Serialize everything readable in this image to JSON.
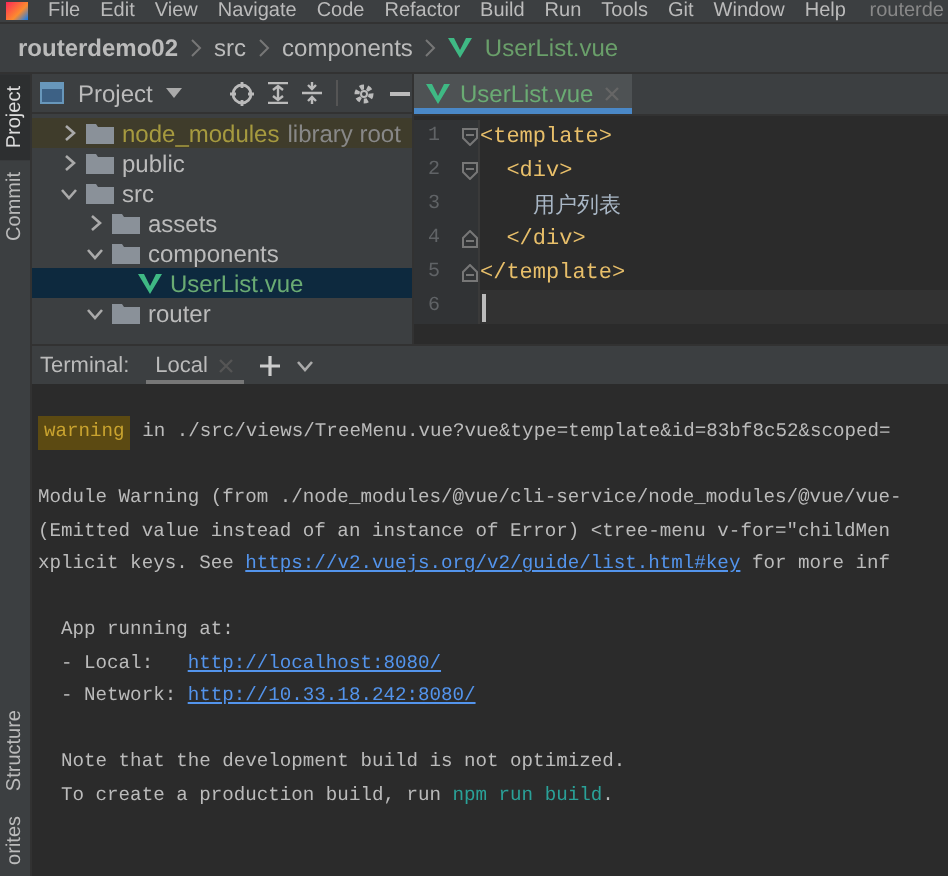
{
  "menu_bar": {
    "items": [
      "File",
      "Edit",
      "View",
      "Navigate",
      "Code",
      "Refactor",
      "Build",
      "Run",
      "Tools",
      "Git",
      "Window",
      "Help"
    ],
    "title": "routerde"
  },
  "breadcrumb": [
    "routerdemo02",
    "src",
    "components",
    "UserList.vue"
  ],
  "tool_strip": {
    "top": [
      {
        "label": "Project",
        "selected": true
      },
      {
        "label": "Commit",
        "selected": false
      }
    ],
    "bottom": [
      "Structure",
      "orites"
    ]
  },
  "project_panel": {
    "title": "Project",
    "tree": [
      {
        "label": "node_modules",
        "note": "library root",
        "kind": "excluded",
        "expanded": false,
        "selected": false
      },
      {
        "label": "public",
        "kind": "folder",
        "expanded": false,
        "selected": false
      },
      {
        "label": "src",
        "kind": "folder",
        "expanded": true,
        "selected": false,
        "children": [
          {
            "label": "assets",
            "kind": "folder",
            "expanded": false,
            "selected": false
          },
          {
            "label": "components",
            "kind": "folder",
            "expanded": true,
            "selected": false,
            "children": [
              {
                "label": "UserList.vue",
                "kind": "vue",
                "selected": true
              }
            ]
          },
          {
            "label": "router",
            "kind": "folder",
            "expanded": true,
            "selected": false
          }
        ]
      }
    ]
  },
  "editor": {
    "tabs": [
      {
        "label": "UserList.vue",
        "selected": true
      }
    ],
    "lines": [
      {
        "number": "1",
        "fold_start": true,
        "fold_end": false,
        "kind": "tag",
        "text": "<template>",
        "current": false
      },
      {
        "number": "2",
        "fold_start": true,
        "fold_end": false,
        "kind": "tag",
        "text": "  <div>",
        "current": false
      },
      {
        "number": "3",
        "fold_start": false,
        "fold_end": false,
        "kind": "text",
        "text": "    用户列表",
        "current": false
      },
      {
        "number": "4",
        "fold_start": false,
        "fold_end": true,
        "kind": "tag",
        "text": "  </div>",
        "current": false
      },
      {
        "number": "5",
        "fold_start": false,
        "fold_end": true,
        "kind": "tag",
        "text": "</template>",
        "current": false
      },
      {
        "number": "6",
        "fold_start": false,
        "fold_end": false,
        "current": true
      }
    ]
  },
  "terminal": {
    "title": "Terminal:",
    "tabs": [
      {
        "label": "Local",
        "selected": true
      }
    ],
    "blocks": [
      [
        [
          {
            "kind": "badge",
            "text": "warning"
          },
          {
            "kind": "text",
            "text": " in ./src/views/TreeMenu.vue?vue&type=template&id=83bf8c52&scoped="
          }
        ]
      ],
      [
        [
          {
            "kind": "text",
            "text": "Module Warning (from ./node_modules/@vue/cli-service/node_modules/@vue/vue-"
          }
        ],
        [
          {
            "kind": "text",
            "text": "(Emitted value instead of an instance of Error) <tree-menu v-for=\"childMen"
          }
        ],
        [
          {
            "kind": "text",
            "text": "xplicit keys. See "
          },
          {
            "kind": "link",
            "text": "https://v2.vuejs.org/v2/guide/list.html#key"
          },
          {
            "kind": "text",
            "text": " for more inf"
          }
        ]
      ],
      [
        [
          {
            "kind": "text",
            "text": "  App running at:"
          }
        ],
        [
          {
            "kind": "text",
            "text": "  - Local:   "
          },
          {
            "kind": "link",
            "text": "http://localhost:8080/"
          }
        ],
        [
          {
            "kind": "text",
            "text": "  - Network: "
          },
          {
            "kind": "link",
            "text": "http://10.33.18.242:8080/"
          }
        ]
      ],
      [
        [
          {
            "kind": "text",
            "text": "  Note that the development build is not optimized."
          }
        ],
        [
          {
            "kind": "text",
            "text": "  To create a production build, run "
          },
          {
            "kind": "command",
            "text": "npm run build"
          },
          {
            "kind": "text",
            "text": "."
          }
        ]
      ]
    ]
  }
}
